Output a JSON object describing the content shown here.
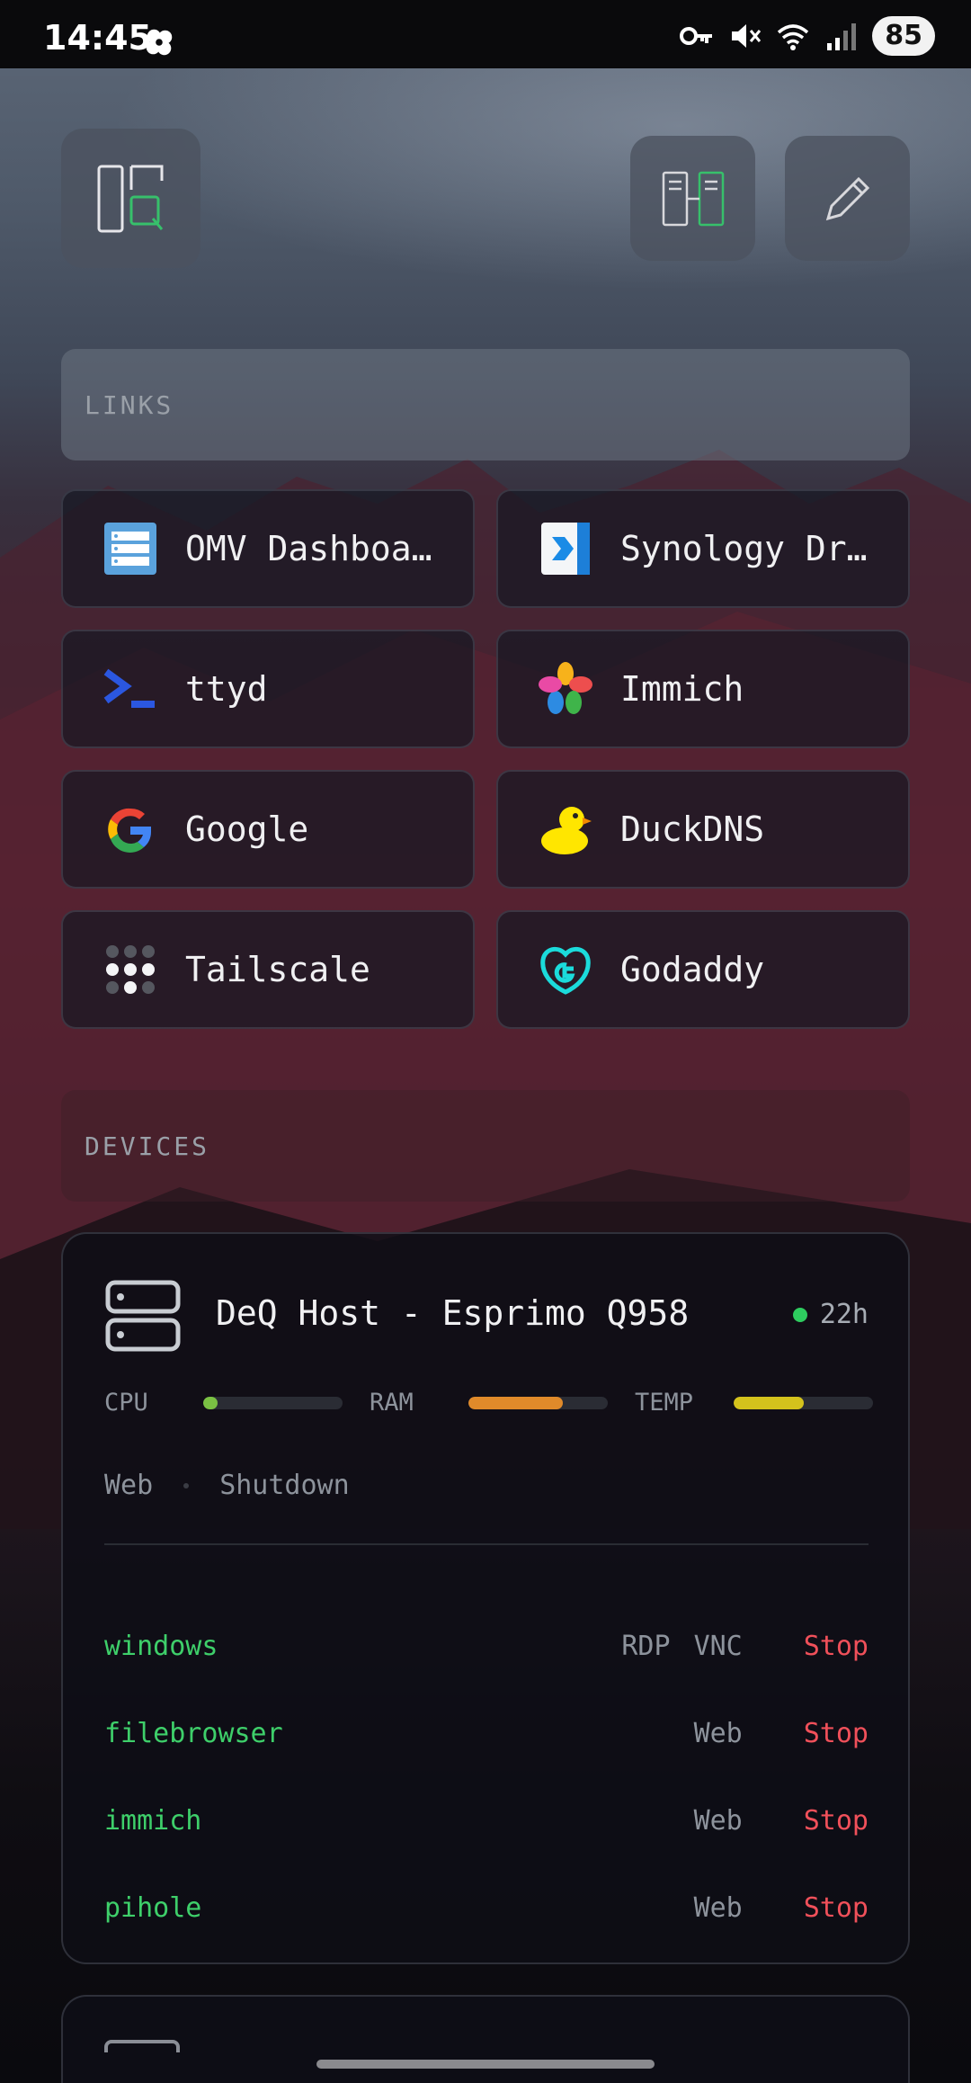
{
  "status_bar": {
    "time": "14:45",
    "battery": "85",
    "icons": [
      "pinwheel-icon",
      "vpn-key-icon",
      "mute-icon",
      "wifi-icon",
      "signal-icon"
    ]
  },
  "toolbar": {
    "logo": "deq-logo-icon",
    "layout_icon": "split-layout-icon",
    "edit_icon": "pencil-icon"
  },
  "links_section": {
    "title": "LINKS",
    "items": [
      {
        "label": "OMV Dashboa…",
        "icon": "omv-icon"
      },
      {
        "label": "Synology Dr…",
        "icon": "synology-drive-icon"
      },
      {
        "label": "ttyd",
        "icon": "terminal-icon"
      },
      {
        "label": "Immich",
        "icon": "immich-icon"
      },
      {
        "label": "Google",
        "icon": "google-icon"
      },
      {
        "label": "DuckDNS",
        "icon": "duck-icon"
      },
      {
        "label": "Tailscale",
        "icon": "tailscale-icon"
      },
      {
        "label": "Godaddy",
        "icon": "godaddy-icon"
      }
    ]
  },
  "devices_section": {
    "title": "DEVICES",
    "device": {
      "name": "DeQ Host - Esprimo Q958",
      "uptime": "22h",
      "status_color": "#2ecc5f",
      "metrics": [
        {
          "label": "CPU",
          "level": 0.05,
          "color": "#7ac143"
        },
        {
          "label": "RAM",
          "level": 0.68,
          "color": "#e08a2a"
        },
        {
          "label": "TEMP",
          "level": 0.5,
          "color": "#d4c21c"
        }
      ],
      "actions": [
        "Web",
        "Shutdown"
      ],
      "services": [
        {
          "name": "windows",
          "options": [
            "RDP",
            "VNC"
          ],
          "stop": "Stop"
        },
        {
          "name": "filebrowser",
          "options": [
            "Web"
          ],
          "stop": "Stop"
        },
        {
          "name": "immich",
          "options": [
            "Web"
          ],
          "stop": "Stop"
        },
        {
          "name": "pihole",
          "options": [
            "Web"
          ],
          "stop": "Stop"
        }
      ]
    }
  }
}
